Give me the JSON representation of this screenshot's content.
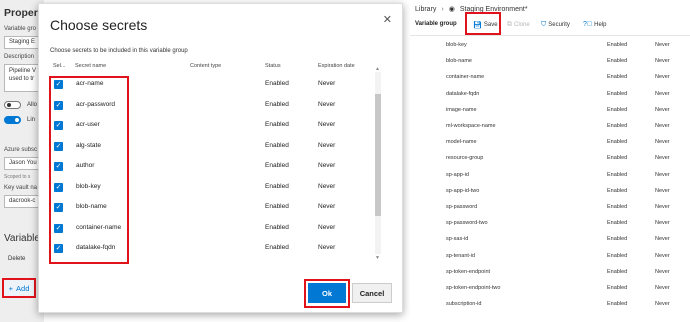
{
  "left_panel": {
    "title": "Properti",
    "variable_group_label": "Variable gro",
    "variable_group_value": "Staging E",
    "description_label": "Description",
    "description_line1": "Pipeline V",
    "description_line2": "used to tr",
    "toggle_allow_label": "Allo",
    "toggle_link_label": "Lin",
    "azure_sub_label": "Azure subsc",
    "azure_sub_value": "Jason You",
    "scoped_label": "Scoped to s",
    "key_vault_label": "Key vault na",
    "key_vault_value": "dacrook-c",
    "variables_heading": "Variable",
    "delete_label": "Delete",
    "add_label": "Add",
    "add_icon": "+"
  },
  "dialog": {
    "title": "Choose secrets",
    "close_icon": "✕",
    "description": "Choose secrets to be included in this variable group",
    "columns": [
      "Sel...",
      "Secret name",
      "Content type",
      "Status",
      "Expiration date"
    ],
    "rows": [
      {
        "name": "acr-name",
        "status": "Enabled",
        "expiration": "Never"
      },
      {
        "name": "acr-password",
        "status": "Enabled",
        "expiration": "Never"
      },
      {
        "name": "acr-user",
        "status": "Enabled",
        "expiration": "Never"
      },
      {
        "name": "alg-state",
        "status": "Enabled",
        "expiration": "Never"
      },
      {
        "name": "author",
        "status": "Enabled",
        "expiration": "Never"
      },
      {
        "name": "blob-key",
        "status": "Enabled",
        "expiration": "Never"
      },
      {
        "name": "blob-name",
        "status": "Enabled",
        "expiration": "Never"
      },
      {
        "name": "container-name",
        "status": "Enabled",
        "expiration": "Never"
      },
      {
        "name": "datalake-fqdn",
        "status": "Enabled",
        "expiration": "Never"
      }
    ],
    "ok_label": "Ok",
    "cancel_label": "Cancel"
  },
  "right_panel": {
    "breadcrumb": {
      "root": "Library",
      "separator": "›",
      "current": "Staging Environment*"
    },
    "tabs": {
      "variable_group": "Variable group",
      "save": "Save",
      "clone": "Clone",
      "security": "Security",
      "help": "Help"
    },
    "variables": [
      {
        "name": "blob-key",
        "status": "Enabled",
        "expiration": "Never"
      },
      {
        "name": "blob-name",
        "status": "Enabled",
        "expiration": "Never"
      },
      {
        "name": "container-name",
        "status": "Enabled",
        "expiration": "Never"
      },
      {
        "name": "datalake-fqdn",
        "status": "Enabled",
        "expiration": "Never"
      },
      {
        "name": "image-name",
        "status": "Enabled",
        "expiration": "Never"
      },
      {
        "name": "ml-workspace-name",
        "status": "Enabled",
        "expiration": "Never"
      },
      {
        "name": "model-name",
        "status": "Enabled",
        "expiration": "Never"
      },
      {
        "name": "resource-group",
        "status": "Enabled",
        "expiration": "Never"
      },
      {
        "name": "sp-app-id",
        "status": "Enabled",
        "expiration": "Never"
      },
      {
        "name": "sp-app-id-two",
        "status": "Enabled",
        "expiration": "Never"
      },
      {
        "name": "sp-password",
        "status": "Enabled",
        "expiration": "Never"
      },
      {
        "name": "sp-password-two",
        "status": "Enabled",
        "expiration": "Never"
      },
      {
        "name": "sp-sas-id",
        "status": "Enabled",
        "expiration": "Never"
      },
      {
        "name": "sp-tenant-id",
        "status": "Enabled",
        "expiration": "Never"
      },
      {
        "name": "sp-token-endpoint",
        "status": "Enabled",
        "expiration": "Never"
      },
      {
        "name": "sp-token-endpoint-two",
        "status": "Enabled",
        "expiration": "Never"
      },
      {
        "name": "subscription-id",
        "status": "Enabled",
        "expiration": "Never"
      }
    ]
  },
  "colors": {
    "accent": "#0078d4",
    "highlight": "#e0131a"
  }
}
